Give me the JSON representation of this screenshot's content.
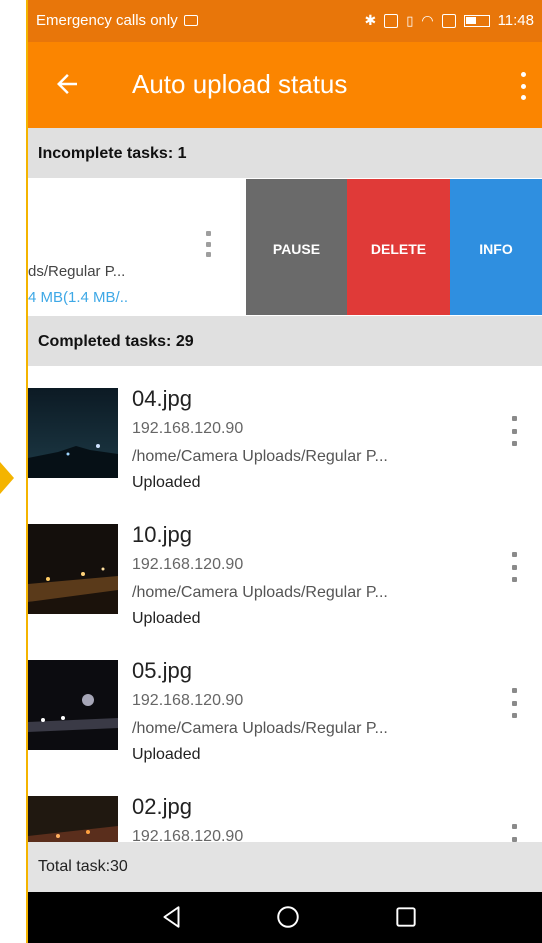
{
  "status_bar": {
    "left_text": "Emergency calls only",
    "time": "11:48"
  },
  "app_bar": {
    "title": "Auto upload status",
    "back_icon": "arrow-back-icon",
    "menu_icon": "more-vert-icon"
  },
  "incomplete": {
    "header": "Incomplete tasks: 1",
    "task": {
      "path": "ds/Regular P...",
      "progress": "4 MB(1.4 MB/.."
    },
    "actions": {
      "pause": "PAUSE",
      "delete": "DELETE",
      "info": "INFO"
    }
  },
  "completed": {
    "header": "Completed tasks: 29",
    "items": [
      {
        "name": "04.jpg",
        "ip": "192.168.120.90",
        "path": "/home/Camera Uploads/Regular P...",
        "status": "Uploaded"
      },
      {
        "name": "10.jpg",
        "ip": "192.168.120.90",
        "path": "/home/Camera Uploads/Regular P...",
        "status": "Uploaded"
      },
      {
        "name": "05.jpg",
        "ip": "192.168.120.90",
        "path": "/home/Camera Uploads/Regular P...",
        "status": "Uploaded"
      },
      {
        "name": "02.jpg",
        "ip": "192.168.120.90",
        "path": "",
        "status": ""
      }
    ]
  },
  "footer": {
    "total": "Total task:30"
  },
  "colors": {
    "accent": "#fb8500",
    "pause": "#6a6a6a",
    "delete": "#e03a38",
    "info": "#2f8fe0",
    "progress_text": "#3ea8e6"
  }
}
